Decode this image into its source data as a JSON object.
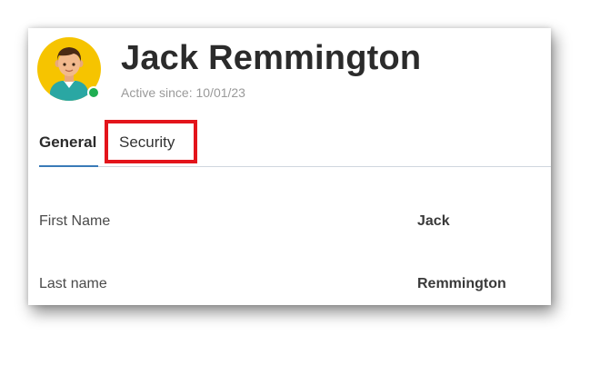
{
  "profile": {
    "name": "Jack Remmington",
    "active_since": "Active since: 10/01/23",
    "avatar_icon": "person-avatar-icon",
    "status_color": "#1fae52",
    "avatar_bg": "#f6c400"
  },
  "tabs": [
    {
      "label": "General",
      "selected": true
    },
    {
      "label": "Security",
      "selected": false,
      "highlighted": true
    }
  ],
  "fields": [
    {
      "label": "First Name",
      "value": "Jack"
    },
    {
      "label": "Last name",
      "value": "Remmington"
    }
  ],
  "colors": {
    "accent": "#3a7ab8",
    "highlight": "#e3141b"
  }
}
